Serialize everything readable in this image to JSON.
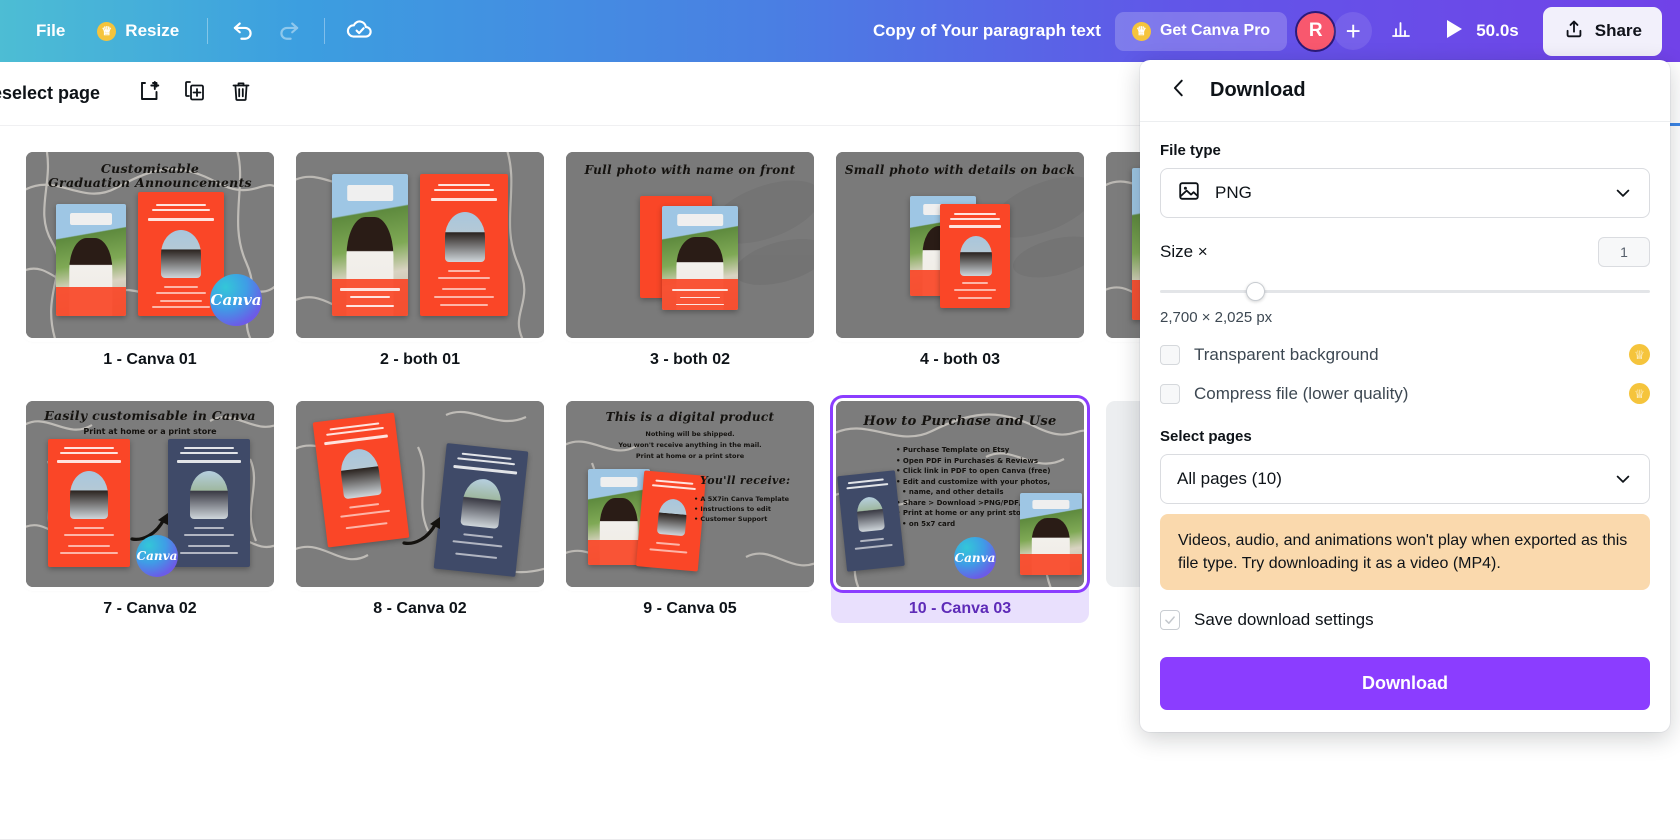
{
  "topbar": {
    "file_label": "File",
    "resize_label": "Resize",
    "undo_icon": "undo-icon",
    "redo_icon": "redo-icon",
    "cloud_icon": "cloud-saved-icon",
    "doc_title": "Copy of Your paragraph text",
    "pro_label": "Get Canva Pro",
    "avatar_initial": "R",
    "add_member_label": "+",
    "analytics_icon": "bar-chart-icon",
    "play_label": "50.0s",
    "share_label": "Share"
  },
  "subbar": {
    "deselect_label": "eselect page",
    "add_page_icon": "add-page-icon",
    "duplicate_icon": "duplicate-page-icon",
    "delete_icon": "trash-icon"
  },
  "pages": [
    {
      "label": "1 - Canva 01",
      "selected": false,
      "headline": "Customisable\nGraduation Announcements",
      "layout": "two-cards-side",
      "canva_badge": true
    },
    {
      "label": "2 - both 01",
      "selected": false,
      "headline": "",
      "layout": "photo-and-red-card",
      "canva_badge": false
    },
    {
      "label": "3 - both 02",
      "selected": false,
      "headline": "Full photo with name on front",
      "layout": "stacked-pair",
      "canva_badge": false
    },
    {
      "label": "4 - both 03",
      "selected": false,
      "headline": "Small photo with details on back",
      "layout": "stacked-pair",
      "canva_badge": false
    },
    {
      "label": "",
      "selected": false,
      "headline": "",
      "layout": "cut-off",
      "canva_badge": false
    },
    {
      "label": "7 - Canva 02",
      "selected": false,
      "headline": "Easily customisable in Canva",
      "subheadline": "Print at home or a print store",
      "layout": "red-and-navy-arrow",
      "canva_badge": true
    },
    {
      "label": "8 - Canva 02",
      "selected": false,
      "headline": "",
      "layout": "tilted-red-and-navy-arrow",
      "canva_badge": false
    },
    {
      "label": "9 - Canva 05",
      "selected": false,
      "headline": "This is a digital product",
      "sub_lines": [
        "Nothing will be shipped.",
        "You won't receive anything in the mail.",
        "Print at home or a print store"
      ],
      "receive_title": "You'll receive:",
      "receive_items": [
        "A 5X7in Canva Template",
        "Instructions to edit",
        "Customer Support"
      ],
      "layout": "digital-product",
      "canva_badge": false
    },
    {
      "label": "10 - Canva 03",
      "selected": true,
      "headline": "How to Purchase and Use",
      "bullets": [
        "Purchase Template on Etsy",
        "Open PDF in Purchases & Reviews",
        "Click link in PDF to open Canva (free)",
        "Edit and customize with your photos,",
        "name, and other details",
        "Share > Download >PNG/PDF/JPG",
        "Print at home or any print store",
        "on 5x7 card"
      ],
      "layout": "how-to",
      "canva_badge": true
    },
    {
      "label": "",
      "selected": false,
      "headline": "",
      "layout": "placeholder",
      "canva_badge": false
    }
  ],
  "panel": {
    "title": "Download",
    "back_icon": "chevron-left-icon",
    "file_type_label": "File type",
    "file_type_value": "PNG",
    "file_type_icon": "image-icon",
    "size_label": "Size ×",
    "size_multiplier": "1",
    "size_dimensions": "2,700 × 2,025 px",
    "options": [
      {
        "label": "Transparent background",
        "checked": false,
        "pro": true
      },
      {
        "label": "Compress file (lower quality)",
        "checked": false,
        "pro": true
      }
    ],
    "select_pages_label": "Select pages",
    "select_pages_value": "All pages (10)",
    "warning": "Videos, audio, and animations won't play when exported as this file type. Try downloading it as a video (MP4).",
    "save_settings_label": "Save download settings",
    "save_settings_checked": true,
    "download_button": "Download"
  },
  "colors": {
    "brand_purple": "#8b3dff",
    "selected_purple": "#5e2bb8",
    "selected_bg": "#e9e0fd",
    "warning_bg": "#fad9ad",
    "pro_gold": "#f5c43c",
    "avatar_red": "#f8586e",
    "card_red": "#fa4627",
    "card_navy": "#3f4a68",
    "thumb_gray": "#7c7c7c"
  }
}
